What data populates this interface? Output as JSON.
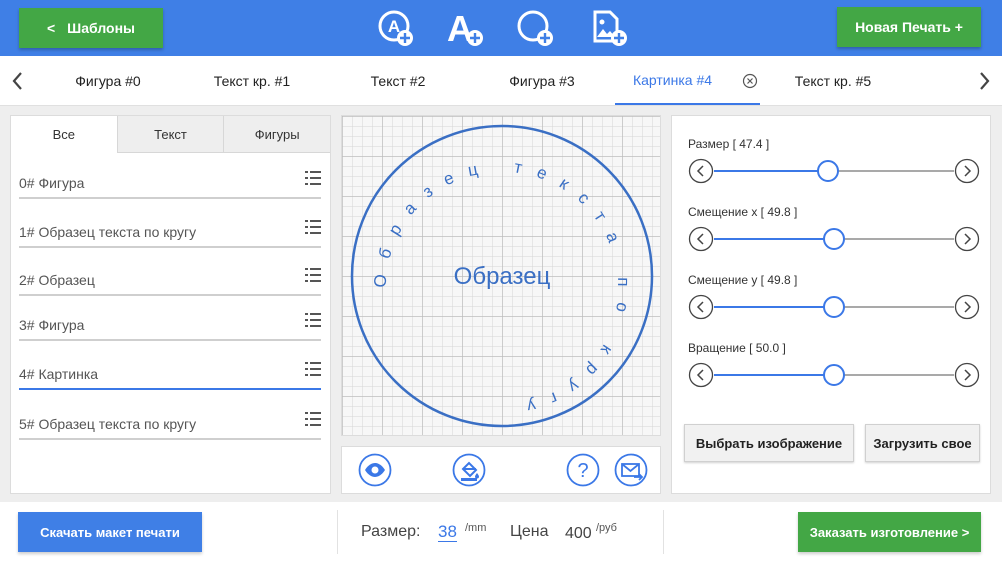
{
  "header": {
    "back_label": "Шаблоны",
    "back_chevron": "<",
    "new_print_label": "Новая Печать +",
    "tools": [
      "add-text-circle-icon",
      "add-text-icon",
      "add-shape-icon",
      "add-image-icon"
    ]
  },
  "tabs": [
    {
      "label": "Фигура #0"
    },
    {
      "label": "Текст кр. #1"
    },
    {
      "label": "Текст #2"
    },
    {
      "label": "Фигура #3"
    },
    {
      "label": "Картинка #4",
      "active": true
    },
    {
      "label": "Текст кр. #5"
    }
  ],
  "layers_panel": {
    "filters": [
      "Все",
      "Текст",
      "Фигуры"
    ],
    "active_filter": "Все",
    "items": [
      {
        "label": "0#  Фигура"
      },
      {
        "label": "1#  Образец текста по кругу"
      },
      {
        "label": "2#  Образец"
      },
      {
        "label": "3#  Фигура"
      },
      {
        "label": "4#  Картинка",
        "active": true
      },
      {
        "label": "5#  Образец текста по кругу"
      }
    ]
  },
  "canvas": {
    "center_text": "Образец",
    "circle_text": "Образец текста по кругу",
    "stroke_color": "#3a6fc4"
  },
  "properties": {
    "sliders": [
      {
        "label": "Размер [ 47.4 ]",
        "value": 47.4
      },
      {
        "label": "Смещение x [ 49.8 ]",
        "value": 49.8
      },
      {
        "label": "Смещение y [ 49.8 ]",
        "value": 49.8
      },
      {
        "label": "Вращение [ 50.0 ]",
        "value": 50.0
      }
    ],
    "choose_image_label": "Выбрать изображение",
    "upload_label": "Загрузить свое"
  },
  "footer": {
    "download_label": "Скачать макет печати",
    "size_label": "Размер:",
    "size_value": "38",
    "size_unit": "/mm",
    "price_label": "Цена",
    "price_value": "400",
    "price_unit": "/руб",
    "order_label": "Заказать изготовление >"
  },
  "colors": {
    "primary": "#3f7fe6",
    "green": "#43a745",
    "accent": "#3b78e7"
  }
}
